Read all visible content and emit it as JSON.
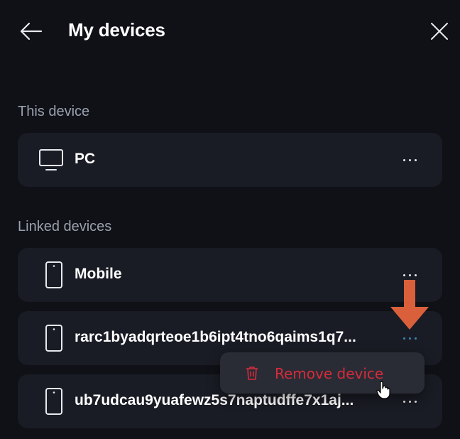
{
  "header": {
    "title": "My devices",
    "back_icon": "arrow-left-icon",
    "close_icon": "close-icon"
  },
  "sections": {
    "this_device": "This device",
    "linked_devices": "Linked devices"
  },
  "devices": {
    "this": {
      "name": "PC",
      "icon": "monitor-icon"
    },
    "linked": [
      {
        "name": "Mobile",
        "icon": "phone-icon"
      },
      {
        "name": "rarc1byadqrteoe1b6ipt4tno6qaims1q7...",
        "icon": "phone-icon"
      },
      {
        "name": "ub7udcau9yuafewz5s7naptudffe7x1aj...",
        "icon": "phone-icon"
      }
    ]
  },
  "context_menu": {
    "remove_label": "Remove device",
    "remove_icon": "trash-icon"
  },
  "colors": {
    "background": "#0f1117",
    "card": "#1a1c25",
    "danger": "#d52b3c",
    "active_dots": "#3d87b5",
    "annotation": "#d9603b"
  }
}
